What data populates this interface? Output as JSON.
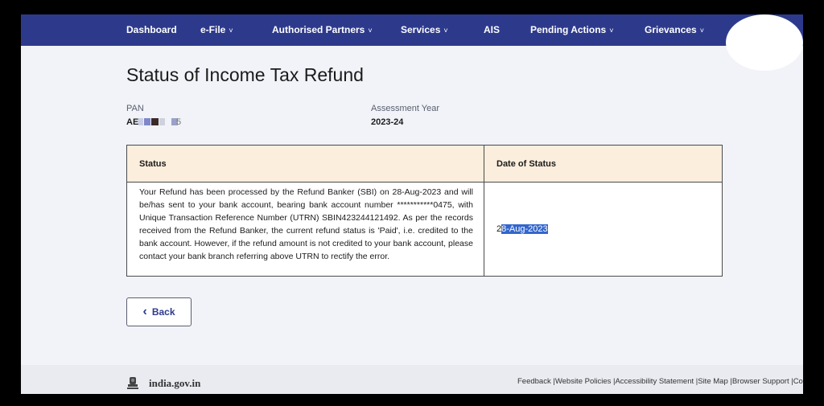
{
  "nav": {
    "items": [
      {
        "label": "Dashboard",
        "has_menu": false
      },
      {
        "label": "e-File",
        "has_menu": true
      },
      {
        "label": "Authorised Partners",
        "has_menu": true
      },
      {
        "label": "Services",
        "has_menu": true
      },
      {
        "label": "AIS",
        "has_menu": false
      },
      {
        "label": "Pending Actions",
        "has_menu": true
      },
      {
        "label": "Grievances",
        "has_menu": true
      }
    ],
    "chevron": "˅",
    "color": "#2d3a8c"
  },
  "page": {
    "title": "Status of Income Tax Refund",
    "pan_label": "PAN",
    "pan_value_prefix": "AE",
    "pan_value_suffix": "5",
    "ay_label": "Assessment Year",
    "ay_value": "2023-24"
  },
  "table": {
    "headers": [
      "Status",
      "Date of Status"
    ],
    "header_bg": "#fbeedd",
    "rows": [
      {
        "status": "Your Refund has been processed by the Refund Banker (SBI) on 28-Aug-2023 and will be/has sent to your bank account, bearing bank account number ***********0475, with Unique Transaction Reference Number (UTRN) SBIN423244121492. As per the records received from the Refund Banker, the current refund status is 'Paid', i.e. credited to the bank account. However, if the refund amount is not credited to your bank account, please contact your bank branch referring above UTRN to rectify the error.",
        "date_first_char": "2",
        "date_selected": "8-Aug-2023"
      }
    ]
  },
  "back_button": {
    "icon": "‹",
    "label": "Back"
  },
  "footer": {
    "brand": "india.gov.in",
    "links": "Feedback |Website Policies |Accessibility Statement |Site Map |Browser Support |CoB"
  }
}
